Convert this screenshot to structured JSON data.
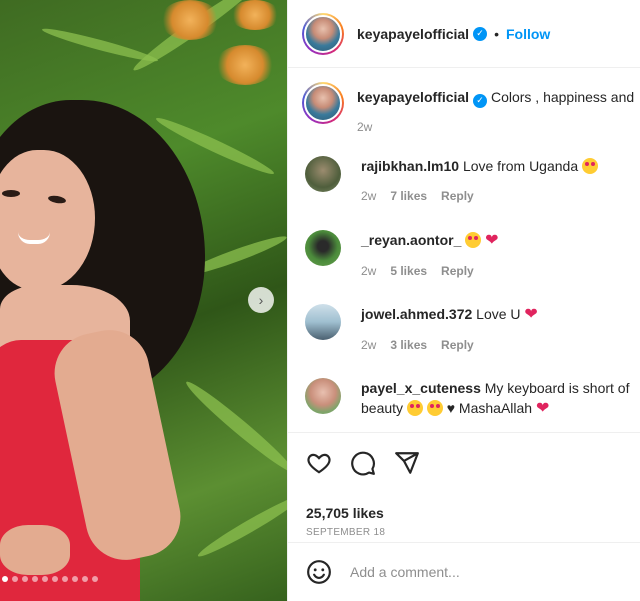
{
  "post": {
    "author": "keyapayelofficial",
    "follow_label": "Follow",
    "separator": "•",
    "caption": "Colors , happiness and",
    "caption_time": "2w",
    "likes": "25,705 likes",
    "date": "SEPTEMBER 18",
    "comment_placeholder": "Add a comment..."
  },
  "media": {
    "next_label": "›",
    "slides_total": 10,
    "active_slide": 1
  },
  "comments": [
    {
      "username": "rajibkhan.lm10",
      "text": "Love from Uganda",
      "time": "2w",
      "likes": "7 likes",
      "reply": "Reply"
    },
    {
      "username": "_reyan.aontor_",
      "text": "",
      "time": "2w",
      "likes": "5 likes",
      "reply": "Reply"
    },
    {
      "username": "jowel.ahmed.372",
      "text": "Love U",
      "time": "2w",
      "likes": "3 likes",
      "reply": "Reply"
    },
    {
      "username": "payel_x_cuteness",
      "text": "My keyboard is short of",
      "text2": "beauty",
      "text3": "♥ MashaAllah"
    }
  ],
  "colors": {
    "link": "#0095f6",
    "meta": "#8e8e8e",
    "heart": "#e0245e",
    "dress": "#e0273d"
  }
}
